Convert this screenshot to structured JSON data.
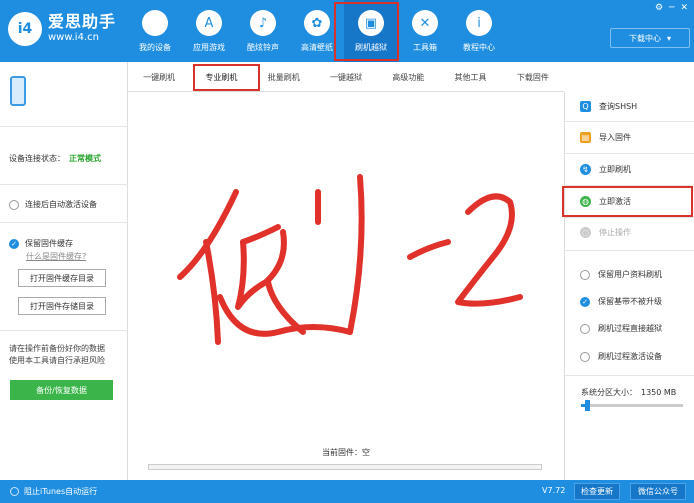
{
  "app": {
    "logo_badge": "i4",
    "title": "爱思助手",
    "url": "www.i4.cn"
  },
  "window_controls": [
    "⚙",
    "─",
    "✕"
  ],
  "download_center": {
    "label": "下载中心",
    "arrow": "▾"
  },
  "nav": [
    {
      "label": "我的设备",
      "icon": "apple-icon",
      "glyph": ""
    },
    {
      "label": "应用游戏",
      "icon": "app-store-icon",
      "glyph": "A"
    },
    {
      "label": "酷炫铃声",
      "icon": "bell-icon",
      "glyph": "♪"
    },
    {
      "label": "高清壁纸",
      "icon": "flower-icon",
      "glyph": "✿"
    },
    {
      "label": "刷机越狱",
      "icon": "box-icon",
      "glyph": "▣"
    },
    {
      "label": "工具箱",
      "icon": "tools-icon",
      "glyph": "✕"
    },
    {
      "label": "教程中心",
      "icon": "info-icon",
      "glyph": "i"
    }
  ],
  "left": {
    "status_label": "设备连接状态：",
    "status_value": "正常模式",
    "auto_activate": "连接后自动激活设备",
    "keep_cache": "保留固件缓存",
    "what_is_cache": "什么是固件缓存?",
    "open_cache_dir": "打开固件缓存目录",
    "open_store_dir": "打开固件存储目录",
    "warning_line1": "请在操作前备份好你的数据",
    "warning_line2": "使用本工具请自行承担风险",
    "backup_button": "备份/恢复数据"
  },
  "tabs": [
    "一键刷机",
    "专业刷机",
    "批量刷机",
    "一键越狱",
    "高级功能",
    "其他工具",
    "下载固件"
  ],
  "center": {
    "current_firmware": "当前固件：空"
  },
  "right": {
    "actions": [
      {
        "label": "查询SHSH",
        "icon": "search-icon",
        "glyph": "Q",
        "color": "#1f8ee0"
      },
      {
        "label": "导入固件",
        "icon": "import-icon",
        "glyph": "▤",
        "color": "#f0a020"
      },
      {
        "label": "立即刷机",
        "icon": "flash-icon",
        "glyph": "↯",
        "color": "#1f8ee0"
      },
      {
        "label": "立即激活",
        "icon": "globe-icon",
        "glyph": "◍",
        "color": "#3bb54a"
      },
      {
        "label": "停止操作",
        "icon": "stop-icon",
        "glyph": "◌",
        "color": "#cccccc"
      }
    ],
    "options": [
      "保留用户资料刷机",
      "保留基带不被升级",
      "刷机过程直接越狱",
      "刷机过程激活设备"
    ],
    "partition_label": "系统分区大小：",
    "partition_value": "1350 MB"
  },
  "footer": {
    "itunes_block": "阻止iTunes自动运行",
    "version": "V7.72",
    "check_update": "检查更新",
    "wechat": "微信公众号"
  }
}
